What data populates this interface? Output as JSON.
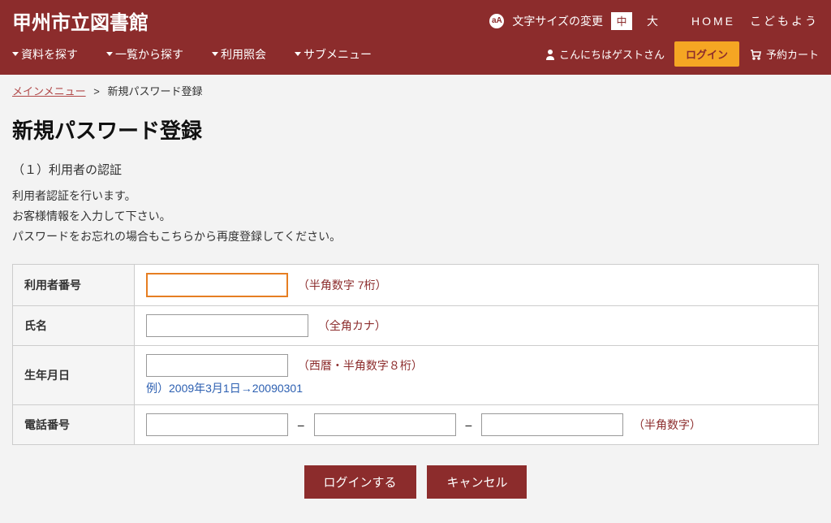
{
  "site_title": "甲州市立図書館",
  "font_size": {
    "label": "文字サイズの変更",
    "medium": "中",
    "large": "大"
  },
  "top_nav": {
    "home": "HOME",
    "kids": "こどもよう"
  },
  "menu": {
    "search": "資料を探す",
    "list": "一覧から探す",
    "usage": "利用照会",
    "submenu": "サブメニュー"
  },
  "user": {
    "greeting": "こんにちはゲストさん",
    "login": "ログイン",
    "cart": "予約カート"
  },
  "breadcrumb": {
    "main": "メインメニュー",
    "sep": ">",
    "current": "新規パスワード登録"
  },
  "page": {
    "title": "新規パスワード登録",
    "step": "（１）利用者の認証",
    "desc1": "利用者認証を行います。",
    "desc2": "お客様情報を入力して下さい。",
    "desc3": "パスワードをお忘れの場合もこちらから再度登録してください。"
  },
  "form": {
    "user_number": {
      "label": "利用者番号",
      "hint": "（半角数字 7桁）"
    },
    "name": {
      "label": "氏名",
      "hint": "（全角カナ）"
    },
    "birth": {
      "label": "生年月日",
      "hint": "（西暦・半角数字８桁）",
      "example": "例）2009年3月1日→20090301"
    },
    "phone": {
      "label": "電話番号",
      "hint": "（半角数字）",
      "dash": "–"
    }
  },
  "buttons": {
    "login": "ログインする",
    "cancel": "キャンセル"
  }
}
